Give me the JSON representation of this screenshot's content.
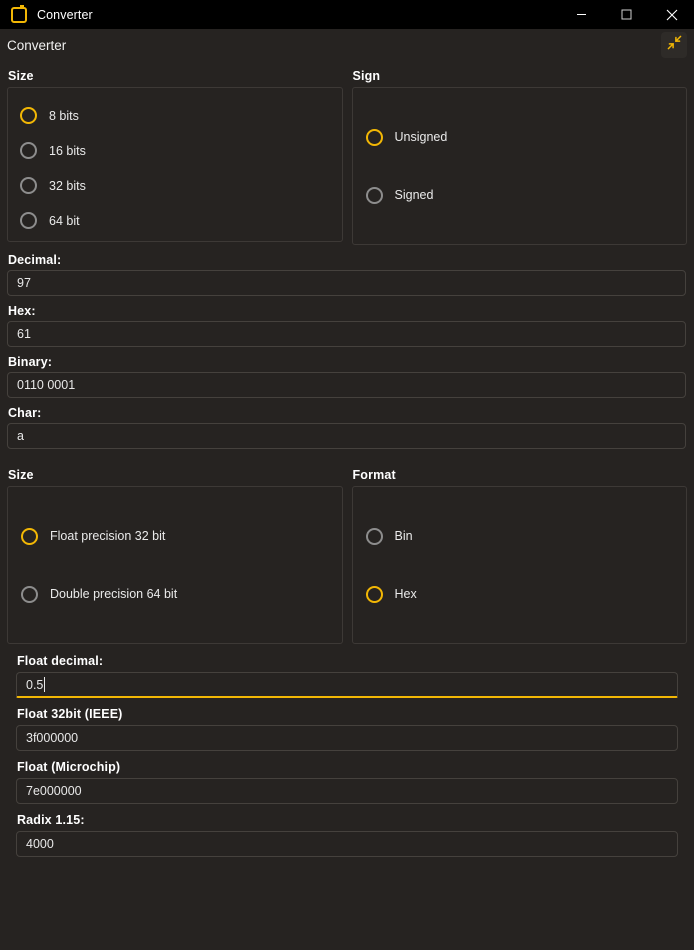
{
  "window": {
    "title": "Converter",
    "icon": "window-icon",
    "controls": {
      "minimize": "minimize-icon",
      "maximize": "maximize-icon",
      "close": "close-icon"
    }
  },
  "header": {
    "title": "Converter",
    "collapse_icon": "collapse-arrows-icon"
  },
  "colors": {
    "background": "#262321",
    "accent": "#f2b705",
    "titlebar": "#000000",
    "border": "#45413d",
    "text": "#eaeaea"
  },
  "integer_section": {
    "size_group": {
      "label": "Size",
      "options": [
        {
          "label": "8 bits",
          "selected": true
        },
        {
          "label": "16 bits",
          "selected": false
        },
        {
          "label": "32 bits",
          "selected": false
        },
        {
          "label": "64 bit",
          "selected": false
        }
      ]
    },
    "sign_group": {
      "label": "Sign",
      "options": [
        {
          "label": "Unsigned",
          "selected": true
        },
        {
          "label": "Signed",
          "selected": false
        }
      ]
    },
    "fields": [
      {
        "label": "Decimal:",
        "value": "97"
      },
      {
        "label": "Hex:",
        "value": "61"
      },
      {
        "label": "Binary:",
        "value": "0110 0001"
      },
      {
        "label": "Char:",
        "value": "a"
      }
    ]
  },
  "float_section": {
    "size_group": {
      "label": "Size",
      "options": [
        {
          "label": "Float precision 32 bit",
          "selected": true
        },
        {
          "label": "Double precision 64 bit",
          "selected": false
        }
      ]
    },
    "format_group": {
      "label": "Format",
      "options": [
        {
          "label": "Bin",
          "selected": false
        },
        {
          "label": "Hex",
          "selected": true
        }
      ]
    },
    "fields": [
      {
        "label": "Float decimal:",
        "value": "0.5",
        "focused": true
      },
      {
        "label": "Float 32bit (IEEE)",
        "value": "3f000000",
        "focused": false
      },
      {
        "label": "Float (Microchip)",
        "value": "7e000000",
        "focused": false
      },
      {
        "label": "Radix 1.15:",
        "value": "4000",
        "focused": false
      }
    ]
  }
}
